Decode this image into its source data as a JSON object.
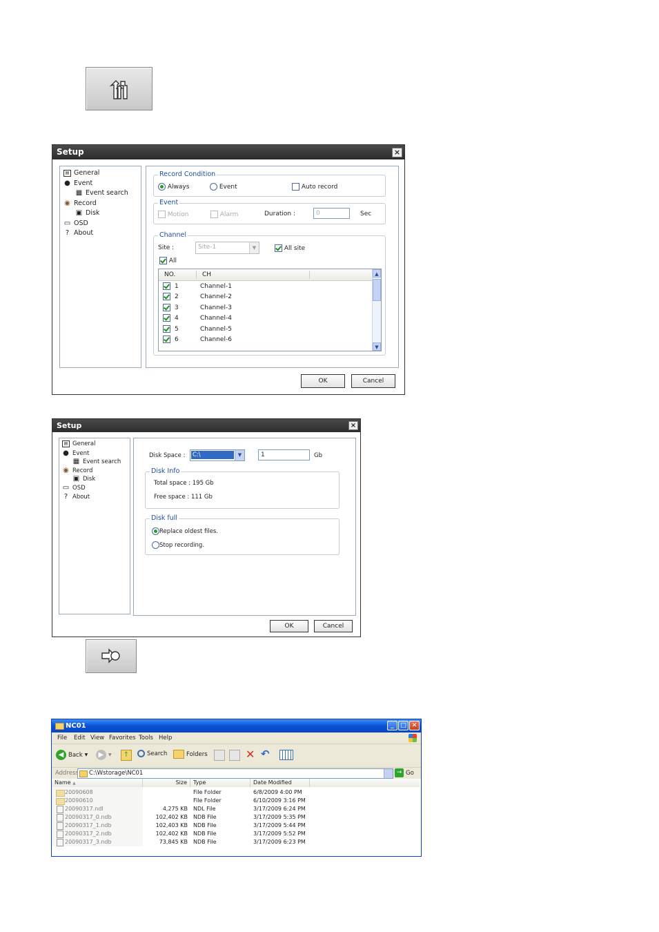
{
  "settings_button": {
    "icon": "tools-icon"
  },
  "record_dialog": {
    "title": "Setup",
    "close": "×",
    "tree": [
      {
        "label": "General",
        "icon": "general-icon"
      },
      {
        "label": "Event",
        "icon": "event-icon"
      },
      {
        "label": "Event search",
        "icon": "event-search-icon"
      },
      {
        "label": "Record",
        "icon": "record-icon"
      },
      {
        "label": "Disk",
        "icon": "disk-icon"
      },
      {
        "label": "OSD",
        "icon": "osd-icon"
      },
      {
        "label": "About",
        "icon": "about-icon"
      }
    ],
    "record_condition": {
      "legend": "Record Condition",
      "always": "Always",
      "event": "Event",
      "auto_record": "Auto record",
      "selected": "Always"
    },
    "event": {
      "legend": "Event",
      "motion": "Motion",
      "alarm": "Alarm",
      "duration_label": "Duration :",
      "duration_value": "0",
      "unit": "Sec"
    },
    "channel": {
      "legend": "Channel",
      "site_label": "Site :",
      "site_value": "Site-1",
      "all_site": "All site",
      "all": "All",
      "columns": [
        "NO.",
        "CH"
      ],
      "rows": [
        {
          "no": "1",
          "ch": "Channel-1"
        },
        {
          "no": "2",
          "ch": "Channel-2"
        },
        {
          "no": "3",
          "ch": "Channel-3"
        },
        {
          "no": "4",
          "ch": "Channel-4"
        },
        {
          "no": "5",
          "ch": "Channel-5"
        },
        {
          "no": "6",
          "ch": "Channel-6"
        }
      ]
    },
    "ok": "OK",
    "cancel": "Cancel"
  },
  "disk_dialog": {
    "title": "Setup",
    "close": "×",
    "tree": [
      {
        "label": "General",
        "icon": "general-icon"
      },
      {
        "label": "Event",
        "icon": "event-icon"
      },
      {
        "label": "Event search",
        "icon": "event-search-icon"
      },
      {
        "label": "Record",
        "icon": "record-icon"
      },
      {
        "label": "Disk",
        "icon": "disk-icon"
      },
      {
        "label": "OSD",
        "icon": "osd-icon"
      },
      {
        "label": "About",
        "icon": "about-icon"
      }
    ],
    "disk_space_label": "Disk Space :",
    "drive_value": "C:\\",
    "size_value": "1",
    "size_unit": "Gb",
    "disk_info": {
      "legend": "Disk Info",
      "total": "Total space : 195 Gb",
      "free": "Free space : 111 Gb"
    },
    "disk_full": {
      "legend": "Disk full",
      "replace": "Replace oldest files.",
      "stop": "Stop recording.",
      "selected": "replace"
    },
    "ok": "OK",
    "cancel": "Cancel"
  },
  "export_button": {
    "icon": "export-icon"
  },
  "explorer": {
    "title": "NC01",
    "menu": [
      "File",
      "Edit",
      "View",
      "Favorites",
      "Tools",
      "Help"
    ],
    "toolbar": {
      "back": "Back",
      "search": "Search",
      "folders": "Folders"
    },
    "address_label": "Address",
    "address_value": "C:\\Wstorage\\NC01",
    "go": "Go",
    "columns": [
      "Name",
      "Size",
      "Type",
      "Date Modified"
    ],
    "files": [
      {
        "name": "20090608",
        "size": "",
        "type": "File Folder",
        "date": "6/8/2009 4:00 PM",
        "icon": "folder-icon"
      },
      {
        "name": "20090610",
        "size": "",
        "type": "File Folder",
        "date": "6/10/2009 3:16 PM",
        "icon": "folder-icon"
      },
      {
        "name": "20090317.ndl",
        "size": "4,275 KB",
        "type": "NDL File",
        "date": "3/17/2009 6:24 PM",
        "icon": "file-icon"
      },
      {
        "name": "20090317_0.ndb",
        "size": "102,402 KB",
        "type": "NDB File",
        "date": "3/17/2009 5:35 PM",
        "icon": "file-icon"
      },
      {
        "name": "20090317_1.ndb",
        "size": "102,403 KB",
        "type": "NDB File",
        "date": "3/17/2009 5:44 PM",
        "icon": "file-icon"
      },
      {
        "name": "20090317_2.ndb",
        "size": "102,402 KB",
        "type": "NDB File",
        "date": "3/17/2009 5:52 PM",
        "icon": "file-icon"
      },
      {
        "name": "20090317_3.ndb",
        "size": "73,845 KB",
        "type": "NDB File",
        "date": "3/17/2009 6:23 PM",
        "icon": "file-icon"
      }
    ]
  }
}
